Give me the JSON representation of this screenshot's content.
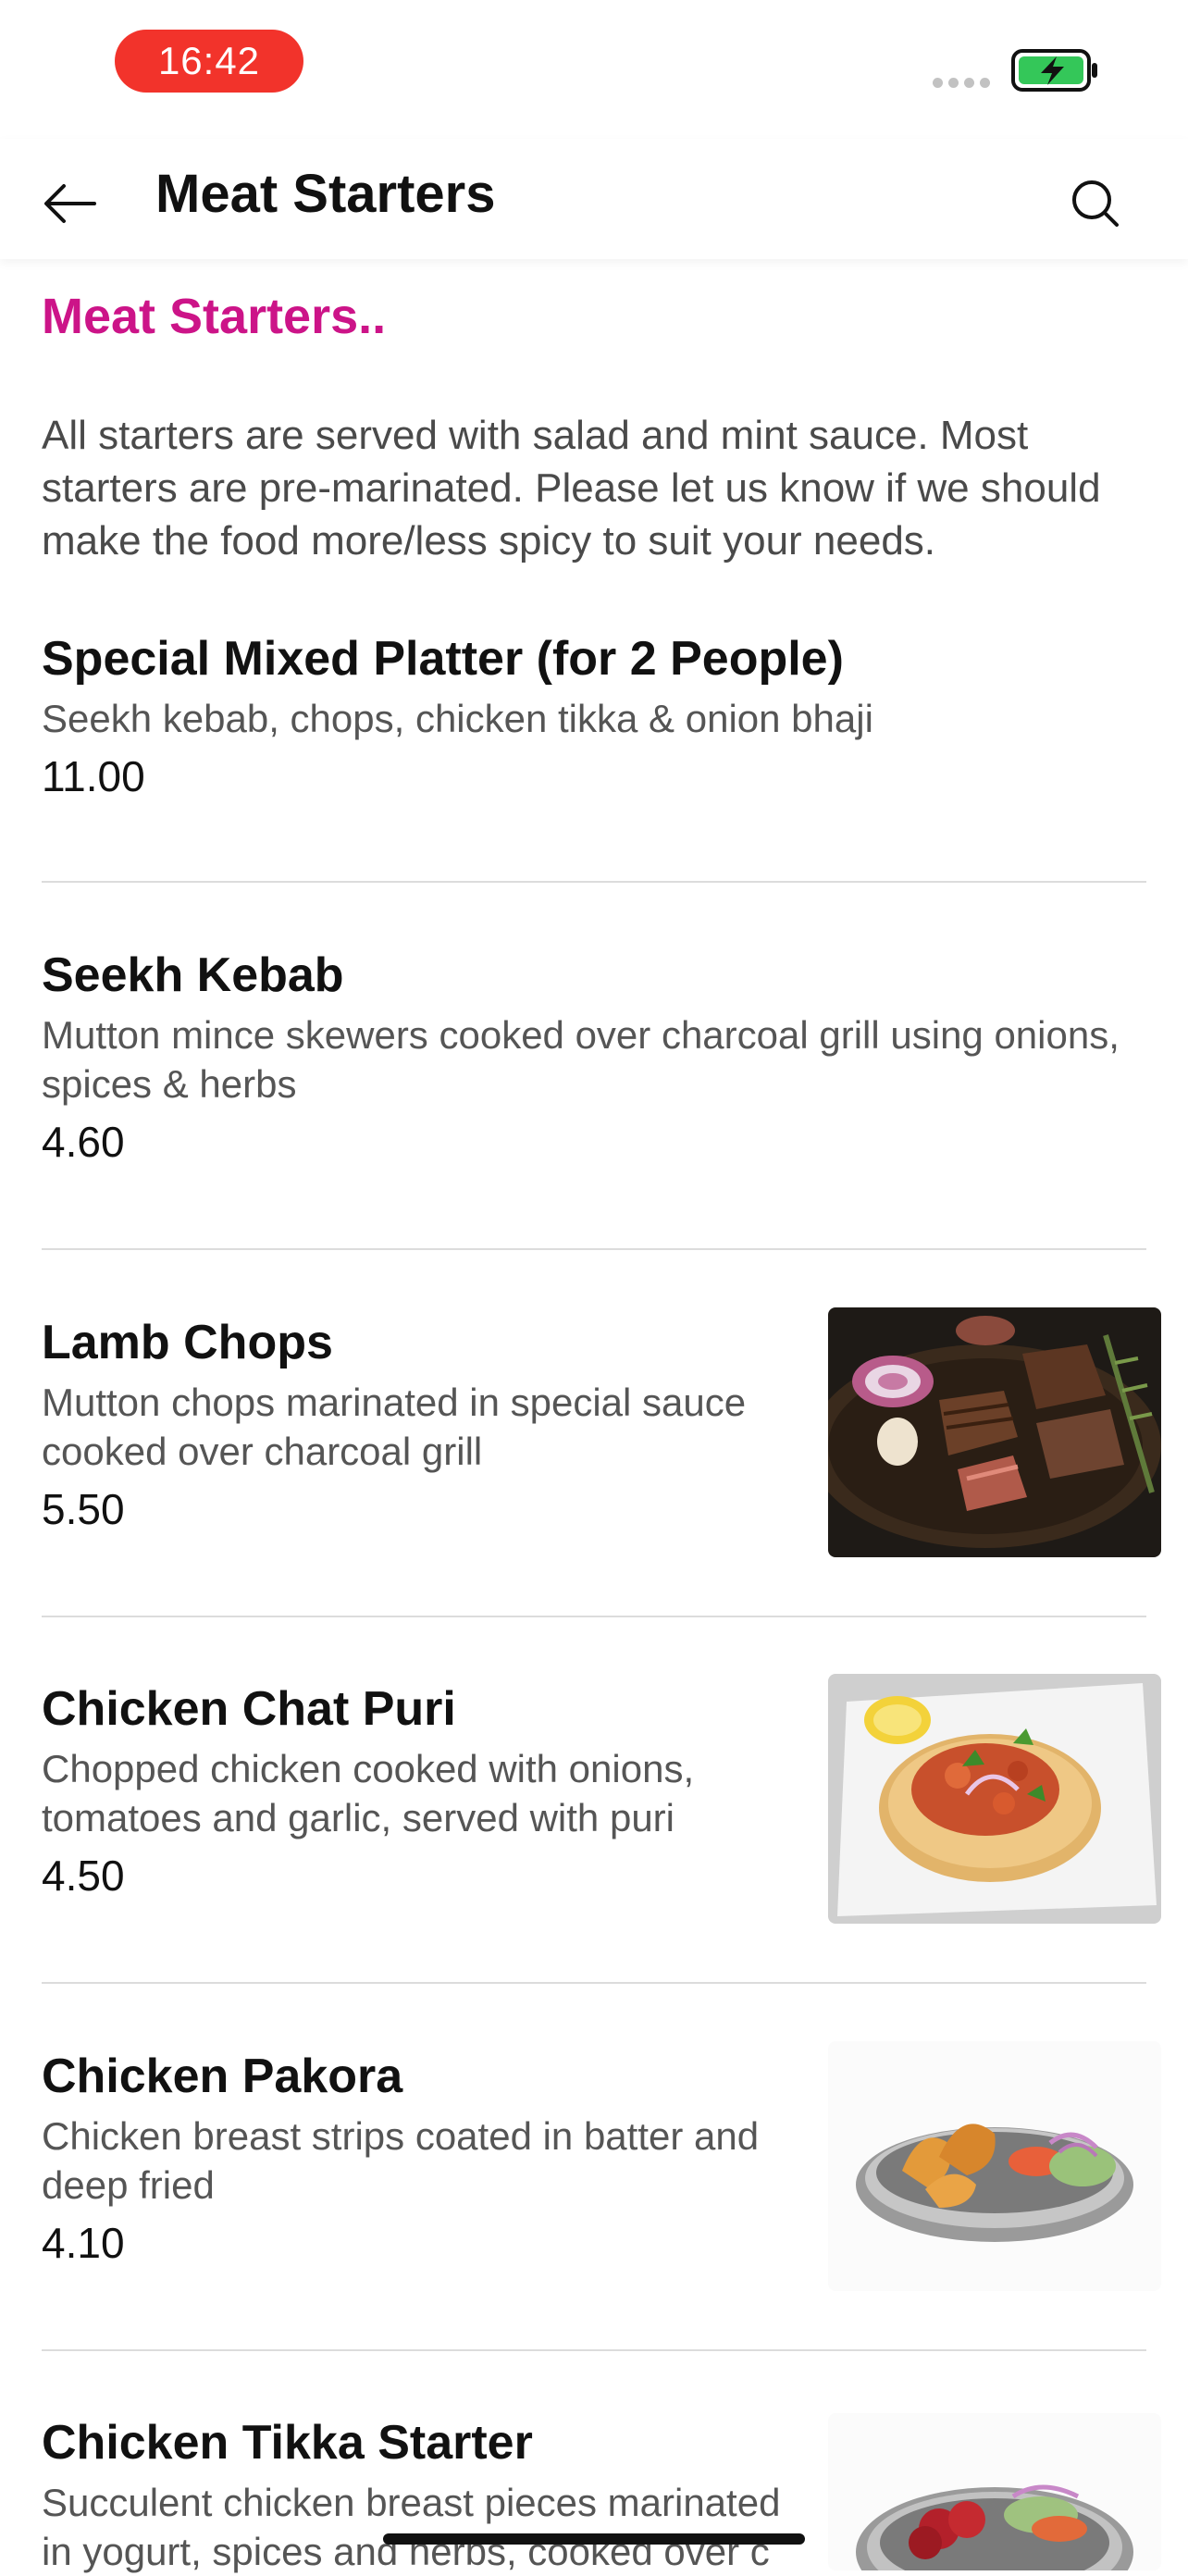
{
  "status_bar": {
    "time": "16:42",
    "pill_color": "#f2332b",
    "battery_icon": "battery-charging-icon",
    "battery_color": "#34c759"
  },
  "nav": {
    "title": "Meat Starters",
    "back_icon": "arrow-left-icon",
    "search_icon": "search-icon"
  },
  "section": {
    "heading": "Meat Starters..",
    "heading_color": "#cc1488",
    "description": "All starters are served with salad and mint sauce. Most starters are pre-marinated. Please let us know if we should make the food more/less spicy to suit your needs."
  },
  "items": [
    {
      "name": "Special Mixed Platter (for 2 People)",
      "description": "Seekh kebab, chops, chicken tikka & onion bhaji",
      "price": "11.00"
    },
    {
      "name": "Seekh Kebab",
      "description": "Mutton mince skewers cooked over charcoal grill using onions, spices & herbs",
      "price": "4.60"
    },
    {
      "name": "Lamb Chops",
      "description": "Mutton chops marinated in special sauce cooked over charcoal grill",
      "price": "5.50",
      "image": "lamb-chops-photo"
    },
    {
      "name": "Chicken Chat Puri",
      "description": "Chopped chicken cooked with onions, tomatoes and garlic, served with puri",
      "price": "4.50",
      "image": "chicken-chat-puri-photo"
    },
    {
      "name": "Chicken Pakora",
      "description": "Chicken breast strips coated in batter and deep fried",
      "price": "4.10",
      "image": "chicken-pakora-photo"
    },
    {
      "name": "Chicken Tikka Starter",
      "description": "Succulent chicken breast pieces marinated in yogurt, spices and herbs, cooked over c",
      "image": "chicken-tikka-photo"
    }
  ]
}
